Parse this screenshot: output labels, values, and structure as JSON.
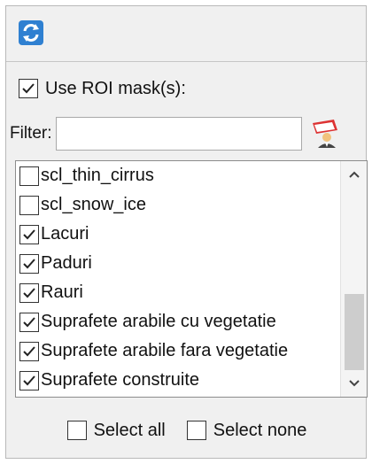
{
  "toolbar": {
    "refresh_icon": "refresh-icon"
  },
  "roi": {
    "label": "Use ROI mask(s):",
    "checked": true
  },
  "filter": {
    "label": "Filter:",
    "value": "",
    "placeholder": "",
    "icon": "filter-icon"
  },
  "mask_list": {
    "items": [
      {
        "label": "scl_thin_cirrus",
        "checked": false
      },
      {
        "label": "scl_snow_ice",
        "checked": false
      },
      {
        "label": "Lacuri",
        "checked": true
      },
      {
        "label": "Paduri",
        "checked": true
      },
      {
        "label": "Rauri",
        "checked": true
      },
      {
        "label": "Suprafete arabile cu vegetatie",
        "checked": true
      },
      {
        "label": "Suprafete arabile fara vegetatie",
        "checked": true
      },
      {
        "label": "Suprafete construite",
        "checked": true
      }
    ],
    "scroll_up_icon": "chevron-up-icon",
    "scroll_down_icon": "chevron-down-icon"
  },
  "bottom": {
    "select_all": "Select all",
    "select_none": "Select none"
  },
  "colors": {
    "accent": "#2f80d1",
    "panel": "#f0f0f0"
  }
}
